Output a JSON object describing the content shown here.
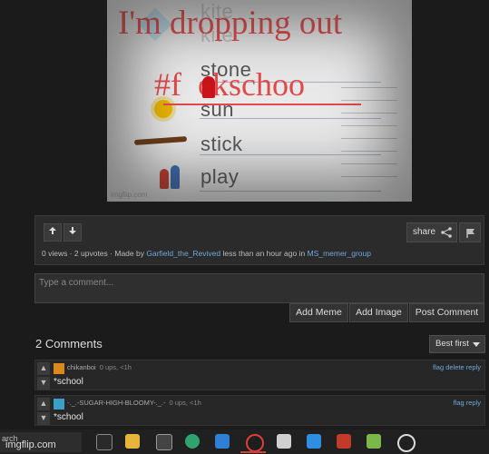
{
  "meme": {
    "caption_top": "I'm dropping out",
    "caption_hashtag": "#f",
    "caption_hashtag_end": "ckschoo",
    "words": [
      "stone",
      "sun",
      "stick",
      "play"
    ],
    "faint_words": [
      "kite",
      "kite"
    ],
    "watermark": "imgflip.com"
  },
  "post": {
    "upvote_icon": "up-arrow-icon",
    "downvote_icon": "down-arrow-icon",
    "share_label": "share",
    "views": "0 views",
    "upvotes": "2 upvotes",
    "made_by_prefix": "Made by",
    "author": "Garfield_the_Revived",
    "time_text": "less than an hour ago in",
    "group": "MS_memer_group"
  },
  "comment_form": {
    "placeholder": "Type a comment...",
    "add_meme": "Add Meme",
    "add_image": "Add Image",
    "post_comment": "Post Comment"
  },
  "comments_section": {
    "title": "2 Comments",
    "sort_label": "Best first"
  },
  "comments": [
    {
      "user": "chikanboi",
      "points": "0 ups, <1h",
      "text": "*school",
      "actions": "flag delete reply",
      "avatar_color": "#d98a1a"
    },
    {
      "user": "-._.-SUGAR-HIGH-BLOOMY-._.-",
      "points": "0 ups, <1h",
      "text": "*school",
      "actions": "flag reply",
      "avatar_color": "#3aa0c8"
    }
  ],
  "taskbar": {
    "search_fragment": "arch",
    "watermark": "imgflip.com"
  }
}
